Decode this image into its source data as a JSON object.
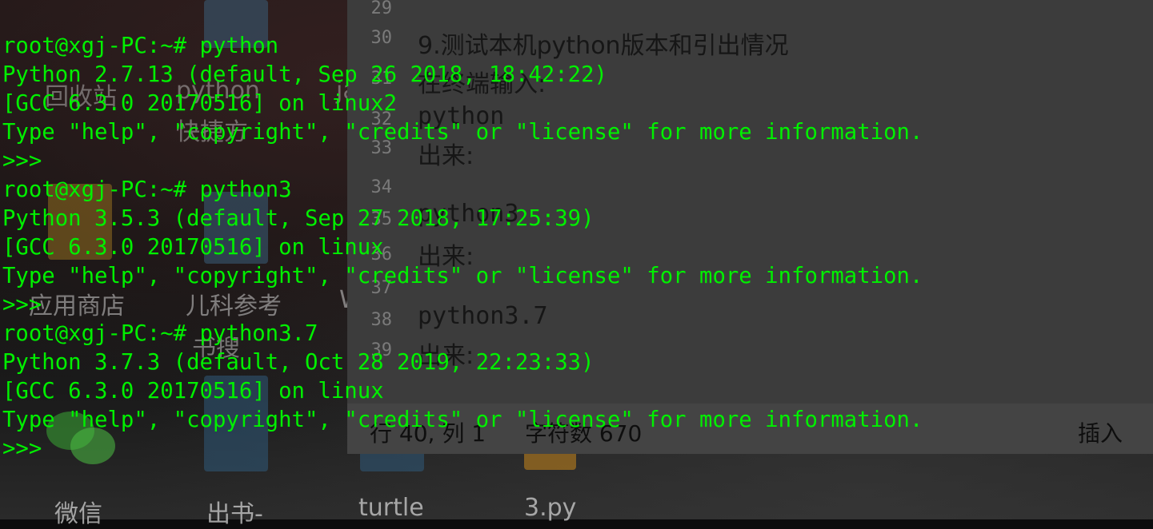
{
  "desktop": {
    "icons": [
      {
        "label": "微信"
      },
      {
        "label": "出书-"
      },
      {
        "label": "turtle"
      },
      {
        "label": "3.py"
      }
    ],
    "faded_labels": [
      "回收站",
      "python",
      "ja",
      "快捷方",
      "应用商店",
      "儿科参考",
      "W",
      "书搜"
    ]
  },
  "editor": {
    "lines": [
      {
        "num": "29",
        "text": ""
      },
      {
        "num": "30",
        "text": "9.测试本机python版本和引出情况"
      },
      {
        "num": "31",
        "text": "在终端输入:"
      },
      {
        "num": "32",
        "text": "python"
      },
      {
        "num": "33",
        "text": "出来:"
      },
      {
        "num": "34",
        "text": ""
      },
      {
        "num": "35",
        "text": "python3"
      },
      {
        "num": "36",
        "text": "出来:"
      },
      {
        "num": "37",
        "text": ""
      },
      {
        "num": "38",
        "text": "python3.7"
      },
      {
        "num": "39",
        "text": "出来:"
      }
    ],
    "status": {
      "position": "行 40, 列 1",
      "char_count": "字符数 670",
      "mode": "插入"
    }
  },
  "terminal": {
    "text_color": "#00f000",
    "lines": [
      "root@xgj-PC:~# python",
      "Python 2.7.13 (default, Sep 26 2018, 18:42:22)",
      "[GCC 6.3.0 20170516] on linux2",
      "Type \"help\", \"copyright\", \"credits\" or \"license\" for more information.",
      ">>>",
      "root@xgj-PC:~# python3",
      "Python 3.5.3 (default, Sep 27 2018, 17:25:39)",
      "[GCC 6.3.0 20170516] on linux",
      "Type \"help\", \"copyright\", \"credits\" or \"license\" for more information.",
      ">>>",
      "root@xgj-PC:~# python3.7",
      "Python 3.7.3 (default, Oct 28 2019, 22:23:33)",
      "[GCC 6.3.0 20170516] on linux",
      "Type \"help\", \"copyright\", \"credits\" or \"license\" for more information.",
      ">>>"
    ]
  }
}
